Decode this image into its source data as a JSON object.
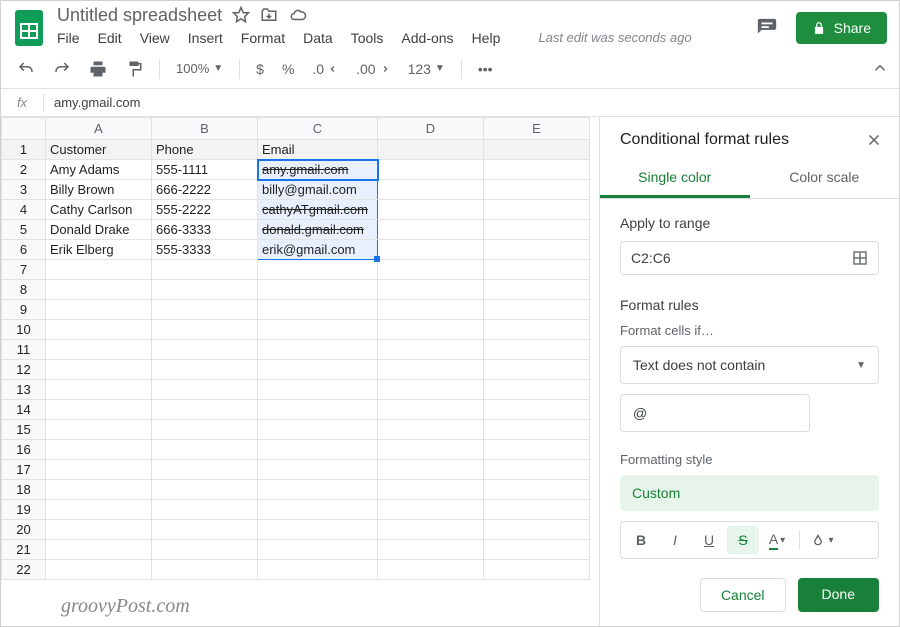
{
  "header": {
    "doc_title": "Untitled spreadsheet",
    "last_edit": "Last edit was seconds ago",
    "share_label": "Share"
  },
  "menubar": [
    "File",
    "Edit",
    "View",
    "Insert",
    "Format",
    "Data",
    "Tools",
    "Add-ons",
    "Help"
  ],
  "toolbar": {
    "zoom": "100%",
    "currency": "$",
    "percent": "%",
    "dec_dec": ".0",
    "dec_inc": ".00",
    "more_formats": "123"
  },
  "formula_bar": {
    "fx": "fx",
    "value": "amy.gmail.com"
  },
  "grid": {
    "columns": [
      "A",
      "B",
      "C",
      "D",
      "E"
    ],
    "headers": {
      "A": "Customer",
      "B": "Phone",
      "C": "Email"
    },
    "rows": [
      {
        "A": "Amy Adams",
        "B": "555-1111",
        "C": "amy.gmail.com",
        "c_invalid": true
      },
      {
        "A": "Billy Brown",
        "B": "666-2222",
        "C": "billy@gmail.com",
        "c_invalid": false
      },
      {
        "A": "Cathy Carlson",
        "B": "555-2222",
        "C": "cathyATgmail.com",
        "c_invalid": true
      },
      {
        "A": "Donald Drake",
        "B": "666-3333",
        "C": "donald.gmail.com",
        "c_invalid": true
      },
      {
        "A": "Erik Elberg",
        "B": "555-3333",
        "C": "erik@gmail.com",
        "c_invalid": false
      }
    ],
    "selection": {
      "active": "C2",
      "range": "C2:C6"
    },
    "visible_row_count": 22
  },
  "sidebar": {
    "title": "Conditional format rules",
    "tabs": {
      "single": "Single color",
      "scale": "Color scale"
    },
    "apply_label": "Apply to range",
    "range_value": "C2:C6",
    "format_rules_label": "Format rules",
    "cells_if_label": "Format cells if…",
    "condition": "Text does not contain",
    "condition_value": "@",
    "style_label": "Formatting style",
    "style_name": "Custom",
    "cancel": "Cancel",
    "done": "Done"
  },
  "watermark": "groovyPost.com"
}
